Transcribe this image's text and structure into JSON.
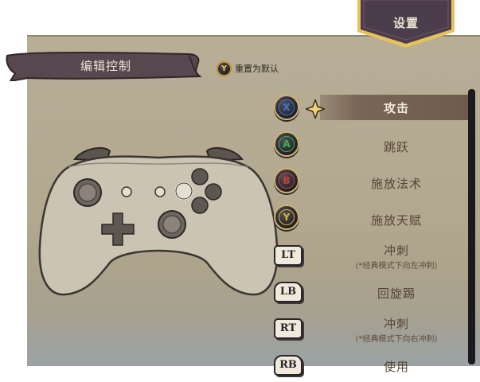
{
  "header": {
    "settings_label": "设置"
  },
  "title_ribbon": {
    "label": "编辑控制"
  },
  "reset": {
    "button": "Y",
    "label": "重置为默认"
  },
  "mappings": [
    {
      "button": "X",
      "button_color": "#3f72d0",
      "action": "攻击",
      "note": "",
      "selected": true
    },
    {
      "button": "A",
      "button_color": "#3fb04a",
      "action": "跳跃",
      "note": "",
      "selected": false
    },
    {
      "button": "B",
      "button_color": "#d03a36",
      "action": "施放法术",
      "note": "",
      "selected": false
    },
    {
      "button": "Y",
      "button_color": "#e0b429",
      "action": "施放天赋",
      "note": "",
      "selected": false
    },
    {
      "button": "LT",
      "action": "冲刺",
      "note": "(*经典模式下向左冲刺)",
      "selected": false
    },
    {
      "button": "LB",
      "action": "回旋踢",
      "note": "",
      "selected": false
    },
    {
      "button": "RT",
      "action": "冲刺",
      "note": "(*经典模式下向右冲刺)",
      "selected": false
    },
    {
      "button": "RB",
      "action": "使用",
      "note": "",
      "selected": false
    }
  ],
  "colors": {
    "panel": "#b2a78f",
    "ribbon": "#5a4a52",
    "banner": "#4c3d4c",
    "banner_trim": "#e5c25a",
    "highlight": "#7a6657",
    "scrollbar": "#1b1b1f"
  },
  "icons": {
    "selection": "four-point-star-icon",
    "controller": "gamepad-diagram"
  }
}
